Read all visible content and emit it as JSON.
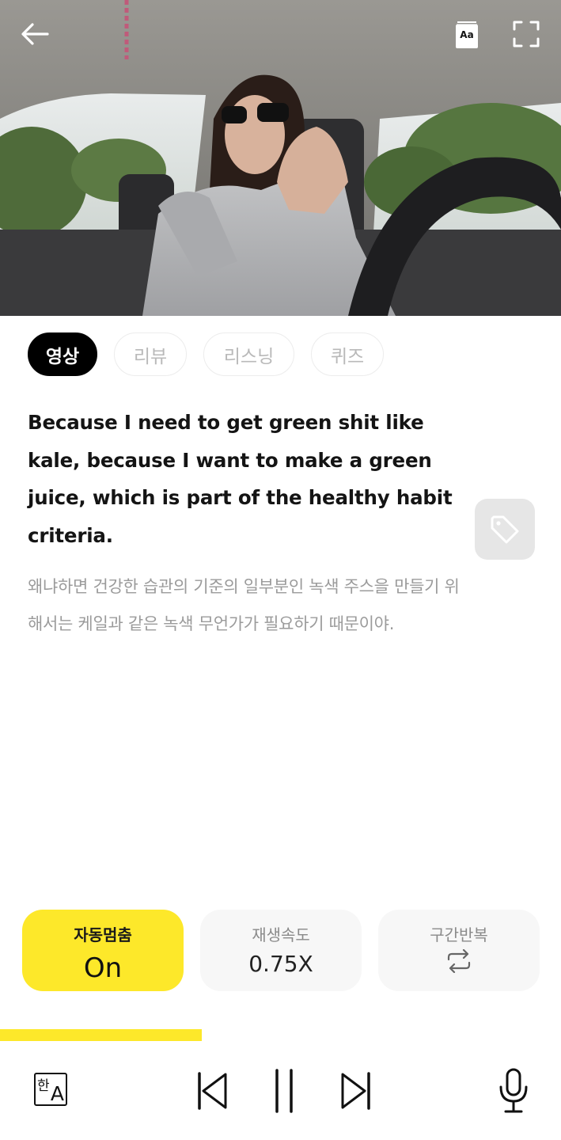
{
  "header": {
    "back_icon": "arrow-left-icon",
    "caption_icon": "caption-book-icon",
    "caption_label": "Aa",
    "fullscreen_icon": "fullscreen-icon"
  },
  "tabs": [
    {
      "label": "영상",
      "active": true
    },
    {
      "label": "리뷰",
      "active": false
    },
    {
      "label": "리스닝",
      "active": false
    },
    {
      "label": "퀴즈",
      "active": false
    }
  ],
  "sentence": {
    "english": "Because I need to get green shit like kale, because I want to make a green juice, which is part of the healthy habit criteria.",
    "korean": "왜냐하면 건강한 습관의 기준의 일부분인 녹색 주스을 만들기 위해서는 케일과 같은 녹색 무언가가 필요하기 때문이야.",
    "tag_icon": "tag-icon"
  },
  "controls": {
    "auto_stop": {
      "label": "자동멈춤",
      "value": "On"
    },
    "speed": {
      "label": "재생속도",
      "value": "0.75X"
    },
    "repeat": {
      "label": "구간반복",
      "icon": "repeat-icon"
    }
  },
  "progress": {
    "fraction": 0.36
  },
  "player": {
    "translate_ko": "한",
    "translate_en": "A",
    "translate_icon": "translate-icon",
    "prev_icon": "skip-previous-icon",
    "pause_icon": "pause-icon",
    "next_icon": "skip-next-icon",
    "mic_icon": "microphone-icon"
  },
  "colors": {
    "accent": "#fde82a",
    "tab_active_bg": "#000000",
    "muted_text": "#9b9b9b"
  }
}
